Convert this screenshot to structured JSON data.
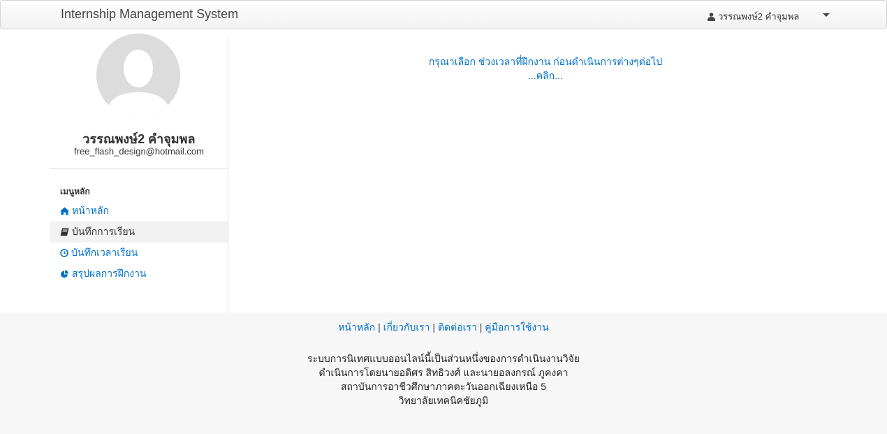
{
  "navbar": {
    "brand": "Internship Management System",
    "user_name": "วรรณพงษ์2 คำจุมพล"
  },
  "profile": {
    "name": "วรรณพงษ์2 คำจุมพล",
    "email": "free_flash_design@hotmail.com"
  },
  "sidebar": {
    "header": "เมนูหลัก",
    "items": [
      {
        "label": "หน้าหลัก",
        "icon": "home-icon",
        "active": false
      },
      {
        "label": "บันทึกการเรียน",
        "icon": "book-icon",
        "active": true
      },
      {
        "label": "บันทึกเวลาเรียน",
        "icon": "clock-icon",
        "active": false
      },
      {
        "label": "สรุปผลการฝึกงาน",
        "icon": "pie-chart-icon",
        "active": false
      }
    ]
  },
  "main": {
    "notice_line1": "กรุณาเลือก ช่วงเวลาที่ฝึกงาน ก่อนดำเนินการต่างๆต่อไป",
    "notice_link": "...คลิก..."
  },
  "footer": {
    "links": [
      "หน้าหลัก",
      "เกี่ยวกับเรา",
      "ติดต่อเรา",
      "คู่มือการใช้งาน"
    ],
    "separator": "|",
    "lines": [
      "ระบบการนิเทศแบบออนไลน์นี้เป็นส่วนหนึ่งของการดำเนินงานวิจัย",
      "ดำเนินการโดยนายอดิศร สิทธิวงศ์ และนายอลงกรณ์ ภูคงคา",
      "สถาบันการอาชีวศึกษาภาคตะวันออกเฉียงเหนือ 5",
      "วิทยาลัยเทคนิคชัยภูมิ"
    ]
  },
  "colors": {
    "link": "#0070c9",
    "footer_bg": "#f7f7f7",
    "active_bg": "#f2f2f2"
  }
}
